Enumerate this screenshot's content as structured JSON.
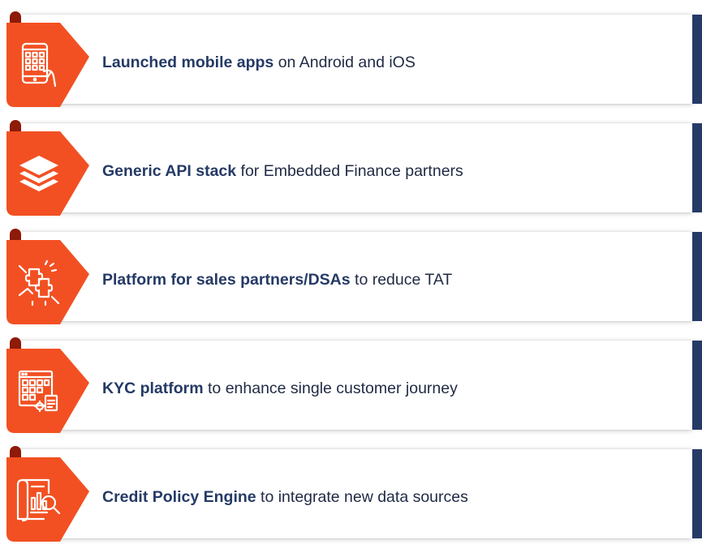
{
  "colors": {
    "badge": "#f25022",
    "badge_dark": "#8e1a08",
    "accent_bar": "#253a66",
    "text": "#1f2a44"
  },
  "items": [
    {
      "icon": "mobile-app-icon",
      "bold": "Launched mobile apps",
      "rest": " on Android and iOS"
    },
    {
      "icon": "layers-stack-icon",
      "bold": "Generic API stack",
      "rest": " for Embedded Finance partners"
    },
    {
      "icon": "puzzle-partnership-icon",
      "bold": "Platform for sales partners/DSAs",
      "rest": " to reduce TAT"
    },
    {
      "icon": "kyc-dashboard-icon",
      "bold": "KYC platform",
      "rest": " to enhance single customer journey"
    },
    {
      "icon": "credit-analysis-icon",
      "bold": "Credit Policy Engine",
      "rest": " to integrate new data sources"
    }
  ]
}
